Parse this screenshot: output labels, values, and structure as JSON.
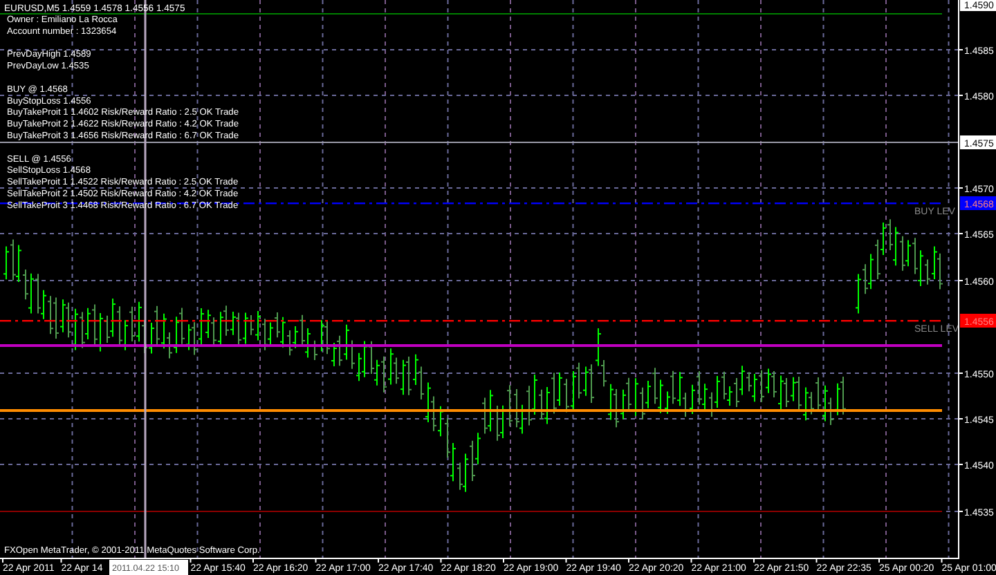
{
  "chart_header": "EURUSD,M5  1.4559 1.4578 1.4556 1.4575",
  "info_groups": [
    [
      "Owner : Emiliano La Rocca",
      "Account number : 1323654"
    ],
    [
      "PrevDayHigh 1.4589",
      "PrevDayLow 1.4535"
    ],
    [
      "BUY @ 1.4568",
      "BuyStopLoss 1.4556",
      "BuyTakeProit 1 1.4602  Risk/Reward Ratio : 2.5  OK Trade",
      "BuyTakeProit 2 1.4622  Risk/Reward Ratio : 4.2  OK Trade",
      "BuyTakeProit 3 1.4656  Risk/Reward Ratio : 6.7  OK Trade"
    ],
    [
      "SELL @ 1.4556",
      "SellStopLoss 1.4568",
      "SellTakeProit 1 1.4522  Risk/Reward Ratio : 2.5  OK Trade",
      "SellTakeProit 2 1.4502  Risk/Reward Ratio : 4.2  OK Trade",
      "SellTakeProit 3 1.4468  Risk/Reward Ratio : 6.7  OK Trade"
    ]
  ],
  "levels": [
    {
      "color": "#008000"
    },
    {
      "color": "#9a9aa8"
    },
    {
      "color": "#0000ff",
      "label": "BUY LEV"
    },
    {
      "color": "#ff0000",
      "label": "SELL LEV"
    },
    {
      "color": "#c000c0"
    },
    {
      "color": "#ff8c00"
    },
    {
      "color": "#8b0000"
    }
  ],
  "price_axis": [
    {
      "kind": "boxed",
      "text": "1.4590",
      "color": "#ffffff"
    },
    {
      "kind": "tick",
      "text": "1.4585"
    },
    {
      "kind": "tick",
      "text": "1.4580"
    },
    {
      "kind": "boxed",
      "text": "1.4575",
      "color": "#ffffff"
    },
    {
      "kind": "tick",
      "text": "1.4570"
    },
    {
      "kind": "boxed",
      "text": "1.4568",
      "color": "#0000ff"
    },
    {
      "kind": "tick",
      "text": "1.4565"
    },
    {
      "kind": "tick",
      "text": "1.4560"
    },
    {
      "kind": "boxed",
      "text": "1.4556",
      "color": "#ff0000"
    },
    {
      "kind": "tick",
      "text": "1.4550"
    },
    {
      "kind": "tick",
      "text": "1.4545"
    },
    {
      "kind": "tick",
      "text": "1.4540"
    },
    {
      "kind": "tick",
      "text": "1.4535"
    }
  ],
  "time_axis": [
    "22 Apr 2011",
    "22 Apr 14",
    "22 Apr 15:40",
    "22 Apr 16:20",
    "22 Apr 17:00",
    "22 Apr 17:40",
    "22 Apr 18:20",
    "22 Apr 19:00",
    "22 Apr 19:40",
    "22 Apr 20:20",
    "22 Apr 21:00",
    "22 Apr 21:50",
    "22 Apr 22:35",
    "25 Apr 00:20",
    "25 Apr 01:00"
  ],
  "crosshair": {
    "time_label": "2011.04.22 15:10"
  },
  "copyright": "FXOpen MetaTrader, © 2001-2011 MetaQuotes Software Corp."
}
